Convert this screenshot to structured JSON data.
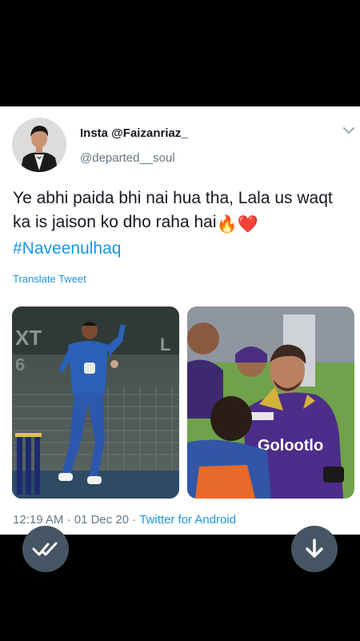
{
  "tweet": {
    "display_name": "Insta @Faizanriaz_",
    "handle": "@departed__soul",
    "text": "Ye abhi paida bhi nai hua tha, Lala us waqt ka is jaison ko dho raha hai",
    "emoji_1": "🔥",
    "emoji_2": "❤️",
    "hashtag": "#Naveenulhaq",
    "translate_label": "Translate Tweet",
    "time": "12:19 AM",
    "date": "01 Dec 20",
    "separator": " · ",
    "source": "Twitter for Android"
  },
  "media": {
    "left_stadium_text": "XT",
    "left_stadium_right": "L",
    "jersey_brand": "Golootlo"
  },
  "colors": {
    "link": "#1b95e0",
    "fab": "#465563",
    "muted": "#657786"
  },
  "icons": [
    "avatar",
    "chevron-down-icon",
    "double-check-icon",
    "download-arrow-icon"
  ]
}
